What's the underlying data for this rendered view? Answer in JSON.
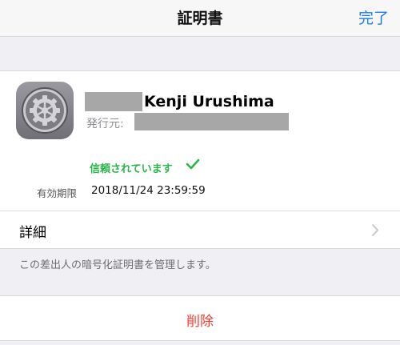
{
  "navbar": {
    "title": "証明書",
    "done_label": "完了"
  },
  "certificate": {
    "icon": "settings-gear-icon",
    "subject_name": "Kenji Urushima",
    "issuer_label": "発行元:",
    "trust_status": "信頼されています",
    "expiry_label": "有効期限",
    "expiry_value": "2018/11/24 23:59:59"
  },
  "details": {
    "label": "詳細"
  },
  "note": "この差出人の暗号化証明書を管理します。",
  "actions": {
    "delete_label": "削除"
  },
  "colors": {
    "accent_blue": "#1a7cf2",
    "trusted_green": "#2bb64a",
    "destructive_red": "#ff3b30",
    "background": "#efeff4"
  }
}
